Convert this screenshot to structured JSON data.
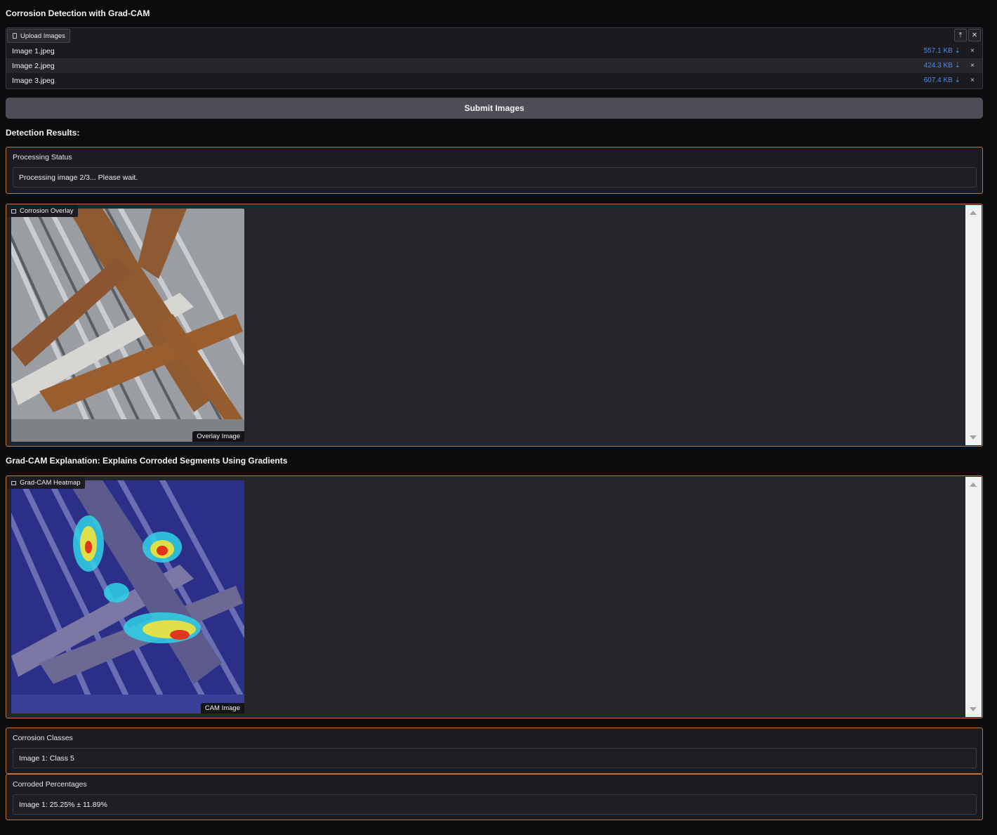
{
  "app_title": "Corrosion Detection with Grad-CAM",
  "upload": {
    "label": "Upload Images",
    "files": [
      {
        "name": "Image 1.jpeg",
        "size": "557.1 KB ⇣"
      },
      {
        "name": "Image 2.jpeg",
        "size": "424.3 KB ⇣"
      },
      {
        "name": "Image 3.jpeg",
        "size": "607.4 KB ⇣"
      }
    ],
    "remove_glyph": "×",
    "upload_icon": "⤒",
    "clear_icon": "✕"
  },
  "submit_label": "Submit Images",
  "results_heading": "Detection Results:",
  "status": {
    "label": "Processing Status",
    "value": "Processing image 2/3... Please wait."
  },
  "overlay": {
    "label": "Corrosion Overlay",
    "caption": "Overlay Image"
  },
  "gradcam_heading": "Grad-CAM Explanation: Explains Corroded Segments Using Gradients",
  "heatmap": {
    "label": "Grad-CAM Heatmap",
    "caption": "CAM Image"
  },
  "classes": {
    "label": "Corrosion Classes",
    "value": "Image 1: Class 5"
  },
  "percentages": {
    "label": "Corroded Percentages",
    "value": "Image 1: 25.25% ± 11.89%"
  },
  "colors": {
    "accent_border": "#c4703a",
    "link_blue": "#4d8bf7",
    "submit_bg": "#4d4d55"
  }
}
